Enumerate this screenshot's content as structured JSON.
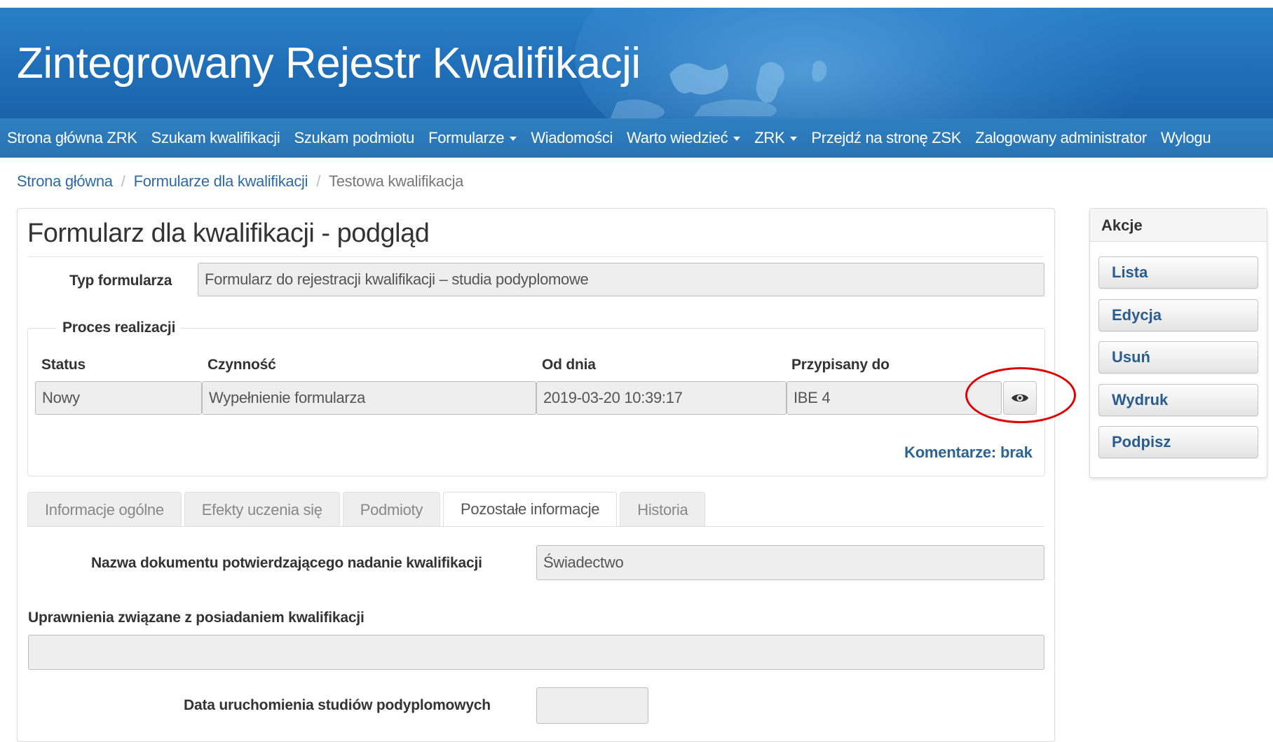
{
  "header": {
    "title": "Zintegrowany Rejestr Kwalifikacji"
  },
  "nav": {
    "items": [
      {
        "label": "Strona główna ZRK",
        "dropdown": false
      },
      {
        "label": "Szukam kwalifikacji",
        "dropdown": false
      },
      {
        "label": "Szukam podmiotu",
        "dropdown": false
      },
      {
        "label": "Formularze",
        "dropdown": true
      },
      {
        "label": "Wiadomości",
        "dropdown": false
      },
      {
        "label": "Warto wiedzieć",
        "dropdown": true
      },
      {
        "label": "ZRK",
        "dropdown": true
      },
      {
        "label": "Przejdź na stronę ZSK",
        "dropdown": false
      },
      {
        "label": "Zalogowany administrator",
        "dropdown": false
      },
      {
        "label": "Wylogu",
        "dropdown": false
      }
    ]
  },
  "breadcrumb": {
    "home": "Strona główna",
    "forms": "Formularze dla kwalifikacji",
    "current": "Testowa kwalifikacja",
    "separator": "/"
  },
  "main": {
    "title": "Formularz dla kwalifikacji - podgląd",
    "form_type_label": "Typ formularza",
    "form_type_value": "Formularz do rejestracji kwalifikacji – studia podyplomowe",
    "process": {
      "legend": "Proces realizacji",
      "headers": {
        "status": "Status",
        "activity": "Czynność",
        "from_date": "Od dnia",
        "assigned_to": "Przypisany do"
      },
      "row": {
        "status": "Nowy",
        "activity": "Wypełnienie formularza",
        "from_date": "2019-03-20 10:39:17",
        "assigned_to": "IBE 4"
      },
      "comments": "Komentarze: brak"
    },
    "tabs": [
      {
        "label": "Informacje ogólne",
        "active": false
      },
      {
        "label": "Efekty uczenia się",
        "active": false
      },
      {
        "label": "Podmioty",
        "active": false
      },
      {
        "label": "Pozostałe informacje",
        "active": true
      },
      {
        "label": "Historia",
        "active": false
      }
    ],
    "doc_name_label": "Nazwa dokumentu potwierdzającego nadanie kwalifikacji",
    "doc_name_value": "Świadectwo",
    "rights_label": "Uprawnienia związane z posiadaniem kwalifikacji",
    "rights_value": "",
    "launch_date_label": "Data uruchomienia studiów podyplomowych",
    "launch_date_value": ""
  },
  "actions": {
    "title": "Akcje",
    "buttons": [
      "Lista",
      "Edycja",
      "Usuń",
      "Wydruk",
      "Podpisz"
    ]
  },
  "colors": {
    "banner": "#1f6fb8",
    "navbar": "#2a77b6",
    "link": "#2d6aa5",
    "highlight_ring": "#e00000"
  }
}
